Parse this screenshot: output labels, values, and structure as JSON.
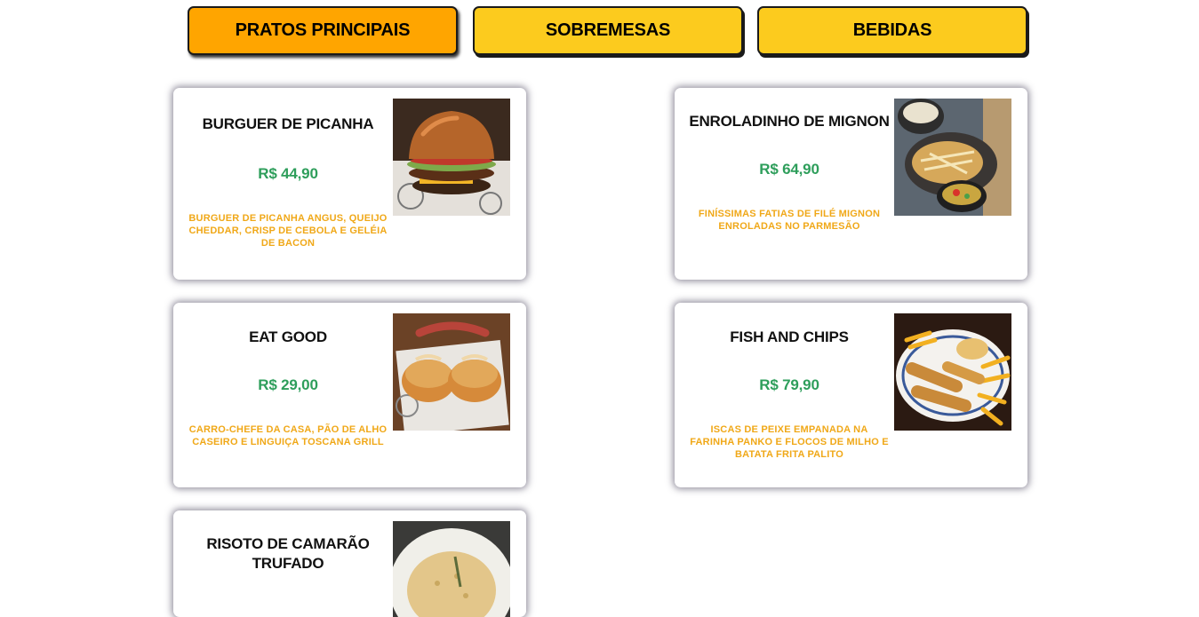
{
  "tabs": [
    {
      "label": "PRATOS PRINCIPAIS",
      "active": true
    },
    {
      "label": "SOBREMESAS",
      "active": false
    },
    {
      "label": "BEBIDAS",
      "active": false
    }
  ],
  "dishes": [
    {
      "name": "BURGUER DE PICANHA",
      "price": "R$ 44,90",
      "description": "BURGUER DE PICANHA ANGUS, QUEIJO CHEDDAR, CRISP DE CEBOLA E GELÉIA DE BACON",
      "image": "burger-photo"
    },
    {
      "name": "ENROLADINHO DE MIGNON",
      "price": "R$ 64,90",
      "description": "FINÍSSIMAS FATIAS DE FILÉ MIGNON ENROLADAS NO PARMESÃO",
      "image": "mignon-photo"
    },
    {
      "name": "EAT GOOD",
      "price": "R$ 29,00",
      "description": "CARRO-CHEFE DA CASA, PÃO DE ALHO CASEIRO E LINGUIÇA TOSCANA GRILL",
      "image": "eat-good-photo"
    },
    {
      "name": "FISH AND CHIPS",
      "price": "R$ 79,90",
      "description": "ISCAS DE PEIXE EMPANADA NA FARINHA PANKO E FLOCOS DE MILHO E BATATA FRITA PALITO",
      "image": "fish-chips-photo"
    },
    {
      "name": "RISOTO DE CAMARÃO TRUFADO",
      "price": "",
      "description": "",
      "image": "risotto-photo"
    }
  ]
}
